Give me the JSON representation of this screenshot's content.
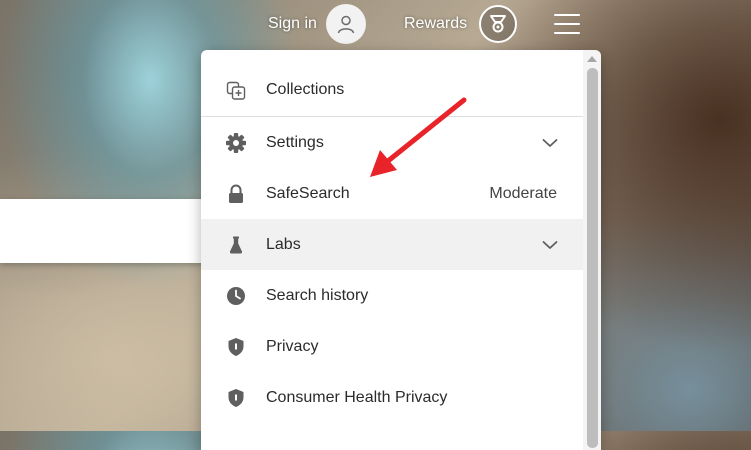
{
  "header": {
    "signin_label": "Sign in",
    "rewards_label": "Rewards",
    "icons": {
      "avatar": "person-icon",
      "rewards": "medal-icon",
      "menu": "hamburger-menu-icon"
    }
  },
  "menu": {
    "items": [
      {
        "label": "Collections",
        "icon": "collections-icon"
      },
      {
        "label": "Settings",
        "icon": "gear-icon",
        "expandable": true
      },
      {
        "label": "SafeSearch",
        "icon": "lock-icon",
        "value": "Moderate"
      },
      {
        "label": "Labs",
        "icon": "flask-icon",
        "expandable": true,
        "highlighted": true
      },
      {
        "label": "Search history",
        "icon": "clock-icon"
      },
      {
        "label": "Privacy",
        "icon": "shield-icon"
      },
      {
        "label": "Consumer Health Privacy",
        "icon": "shield-icon"
      }
    ]
  },
  "colors": {
    "annotation_arrow": "#e8242a",
    "icon_gray": "#5f5f5f",
    "menu_highlight": "#f1f1f1"
  }
}
